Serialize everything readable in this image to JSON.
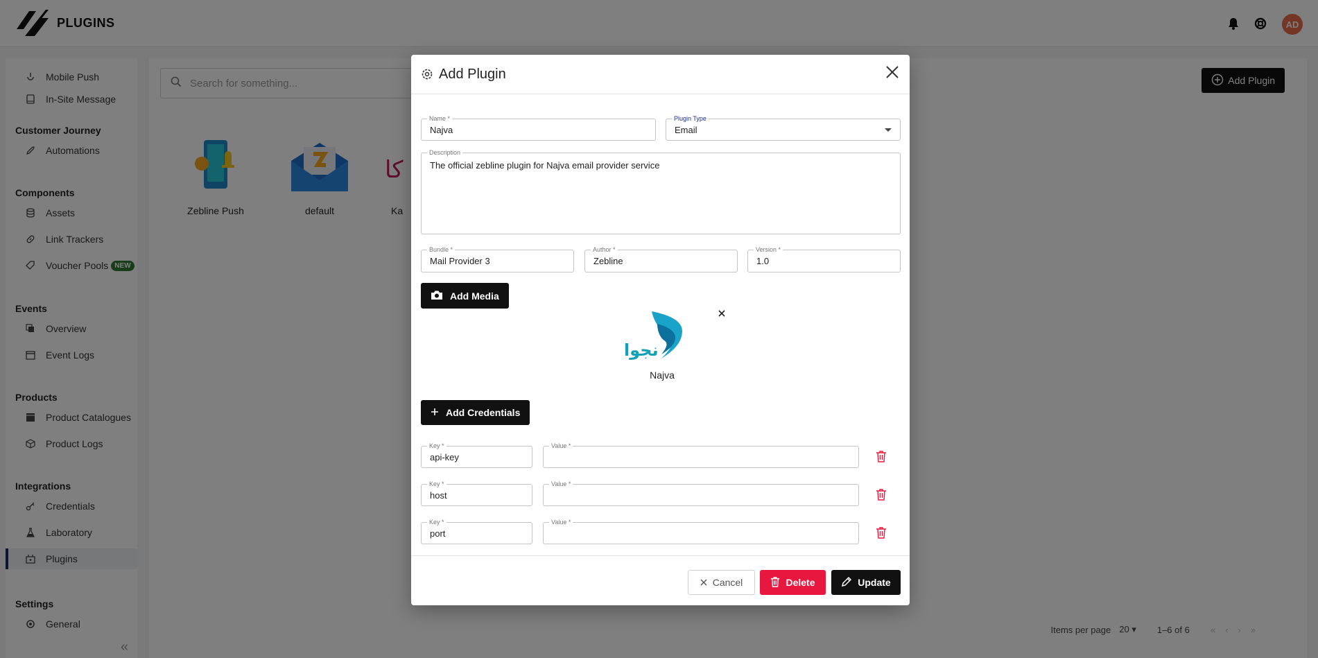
{
  "header": {
    "app_title": "PLUGINS",
    "avatar_initials": "AD",
    "icons": [
      "bell-icon",
      "help-icon"
    ]
  },
  "sidebar": {
    "items_top": [
      {
        "label": "Mobile Push",
        "icon": "mobile-push-icon"
      },
      {
        "label": "In-Site Message",
        "icon": "message-icon"
      }
    ],
    "sections": [
      {
        "title": "Customer Journey",
        "items": [
          {
            "label": "Automations",
            "icon": "rocket-icon"
          }
        ]
      },
      {
        "title": "Components",
        "items": [
          {
            "label": "Assets",
            "icon": "database-icon"
          },
          {
            "label": "Link Trackers",
            "icon": "link-icon"
          },
          {
            "label": "Voucher Pools",
            "icon": "tag-icon",
            "badge": "NEW"
          }
        ]
      },
      {
        "title": "Events",
        "items": [
          {
            "label": "Overview",
            "icon": "layers-icon"
          },
          {
            "label": "Event Logs",
            "icon": "calendar-icon"
          }
        ]
      },
      {
        "title": "Products",
        "items": [
          {
            "label": "Product Catalogues",
            "icon": "catalogue-icon"
          },
          {
            "label": "Product Logs",
            "icon": "box-icon"
          }
        ]
      },
      {
        "title": "Integrations",
        "items": [
          {
            "label": "Credentials",
            "icon": "key-icon"
          },
          {
            "label": "Laboratory",
            "icon": "flask-icon"
          },
          {
            "label": "Plugins",
            "icon": "plugin-icon",
            "active": true
          }
        ]
      },
      {
        "title": "Settings",
        "items": [
          {
            "label": "General",
            "icon": "gear-icon"
          }
        ]
      }
    ]
  },
  "main": {
    "search_placeholder": "Search for something...",
    "add_plugin_label": "Add Plugin",
    "plugins": [
      {
        "name": "Zebline Push"
      },
      {
        "name": "default"
      },
      {
        "name": "Ka"
      }
    ],
    "pager": {
      "items_per_page_label": "Items per page",
      "items_per_page_value": "20",
      "range": "1–6 of 6"
    }
  },
  "modal": {
    "title": "Add Plugin",
    "fields": {
      "name": {
        "label": "Name *",
        "value": "Najva"
      },
      "plugin_type": {
        "label": "Plugin Type",
        "value": "Email"
      },
      "description": {
        "label": "Description",
        "value": "The official zebline plugin for Najva email provider service"
      },
      "bundle": {
        "label": "Bundle *",
        "value": "Mail Provider 3"
      },
      "author": {
        "label": "Author *",
        "value": "Zebline"
      },
      "version": {
        "label": "Version *",
        "value": "1.0"
      }
    },
    "add_media_label": "Add Media",
    "media": {
      "caption": "Najva",
      "logo_text": "نجوا"
    },
    "add_credentials_label": "Add Credentials",
    "credentials": [
      {
        "key_label": "Key *",
        "key": "api-key",
        "value_label": "Value *",
        "value": ""
      },
      {
        "key_label": "Key *",
        "key": "host",
        "value_label": "Value *",
        "value": ""
      },
      {
        "key_label": "Key *",
        "key": "port",
        "value_label": "Value *",
        "value": ""
      }
    ],
    "footer": {
      "cancel_label": "Cancel",
      "delete_label": "Delete",
      "update_label": "Update"
    },
    "colors": {
      "delete": "#e8173f",
      "primary": "#111111"
    }
  }
}
